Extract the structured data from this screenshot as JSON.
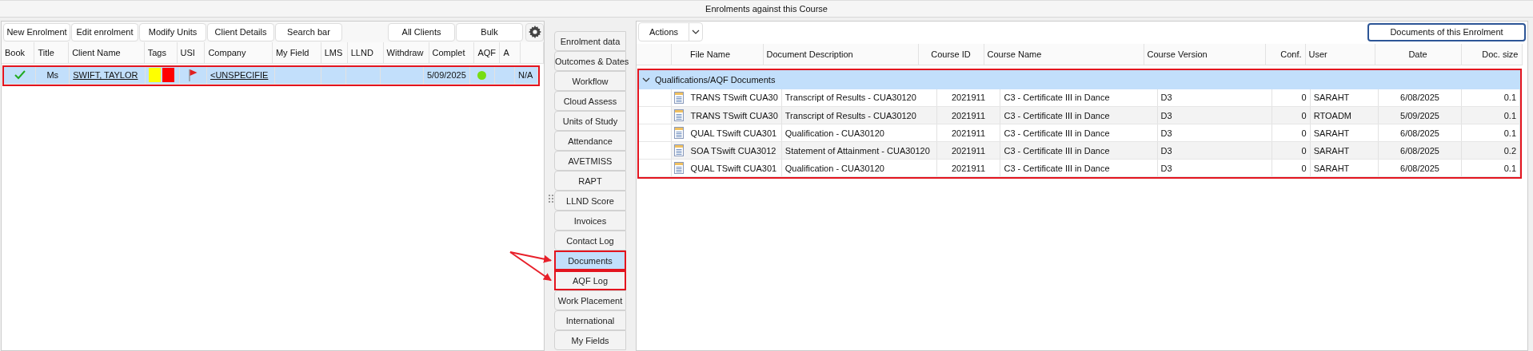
{
  "window": {
    "title": "Enrolments against this Course"
  },
  "enrolments": {
    "toolbar_left": [
      {
        "label": "New Enrolment"
      },
      {
        "label": "Edit enrolment"
      },
      {
        "label": "Modify Units"
      },
      {
        "label": "Client Details"
      },
      {
        "label": "Search bar"
      }
    ],
    "toolbar_right": [
      {
        "label": "All Clients"
      },
      {
        "label": "Bulk"
      }
    ],
    "columns": [
      "Book",
      "Title",
      "Client Name",
      "Tags",
      "USI",
      "Company",
      "My Field",
      "LMS",
      "LLND",
      "Withdraw",
      "Complet",
      "AQF",
      "A",
      ""
    ],
    "rows": [
      {
        "selected": true,
        "highlighted": true,
        "cells": [
          {
            "kind": "check",
            "checked": true
          },
          {
            "kind": "text",
            "text": "Ms"
          },
          {
            "kind": "link",
            "text": "SWIFT, TAYLOR"
          },
          {
            "kind": "tags",
            "tags": [
              {
                "color": "#ffff00"
              },
              {
                "color": "#ff0000"
              }
            ]
          },
          {
            "kind": "flag",
            "flagged": true
          },
          {
            "kind": "link",
            "text": "<UNSPECIFIE"
          },
          {
            "kind": "empty"
          },
          {
            "kind": "empty"
          },
          {
            "kind": "empty"
          },
          {
            "kind": "empty"
          },
          {
            "kind": "text",
            "text": "5/09/2025"
          },
          {
            "kind": "dot",
            "color": "#77dd11"
          },
          {
            "kind": "empty"
          },
          {
            "kind": "text",
            "text": "N/A"
          }
        ]
      }
    ]
  },
  "tabs": [
    {
      "label": "Enrolment data",
      "selected": false,
      "highlighted": false
    },
    {
      "label": "Outcomes & Dates",
      "selected": false,
      "highlighted": false
    },
    {
      "label": "Workflow",
      "selected": false,
      "highlighted": false
    },
    {
      "label": "Cloud Assess",
      "selected": false,
      "highlighted": false
    },
    {
      "label": "Units of Study",
      "selected": false,
      "highlighted": false
    },
    {
      "label": "Attendance",
      "selected": false,
      "highlighted": false
    },
    {
      "label": "AVETMISS",
      "selected": false,
      "highlighted": false
    },
    {
      "label": "RAPT",
      "selected": false,
      "highlighted": false
    },
    {
      "label": "LLND Score",
      "selected": false,
      "highlighted": false
    },
    {
      "label": "Invoices",
      "selected": false,
      "highlighted": false
    },
    {
      "label": "Contact Log",
      "selected": false,
      "highlighted": false
    },
    {
      "label": "Documents",
      "selected": true,
      "highlighted": true
    },
    {
      "label": "AQF Log",
      "selected": false,
      "highlighted": true
    },
    {
      "label": "Work Placement",
      "selected": false,
      "highlighted": false
    },
    {
      "label": "International",
      "selected": false,
      "highlighted": false
    },
    {
      "label": "My Fields",
      "selected": false,
      "highlighted": false
    }
  ],
  "documents": {
    "actions": {
      "label": "Actions"
    },
    "scope_button": {
      "label": "Documents of this Enrolment"
    },
    "columns": [
      "File Name",
      "Document Description",
      "Course ID",
      "Course Name",
      "Course Version",
      "Conf.",
      "User",
      "Date",
      "Doc. size"
    ],
    "groups": [
      {
        "label": "Qualifications/AQF Documents",
        "expanded": true,
        "selected": true,
        "highlighted": true,
        "rows": [
          [
            "TRANS TSwift CUA30",
            "Transcript of Results - CUA30120",
            "2021911",
            "C3 - Certificate III in Dance",
            "D3",
            "0",
            "SARAHT",
            "6/08/2025",
            "0.1"
          ],
          [
            "TRANS TSwift CUA30",
            "Transcript of Results - CUA30120",
            "2021911",
            "C3 - Certificate III in Dance",
            "D3",
            "0",
            "RTOADM",
            "5/09/2025",
            "0.1"
          ],
          [
            "QUAL TSwift CUA301",
            "Qualification - CUA30120",
            "2021911",
            "C3 - Certificate III in Dance",
            "D3",
            "0",
            "SARAHT",
            "6/08/2025",
            "0.1"
          ],
          [
            "SOA TSwift CUA3012",
            "Statement of Attainment - CUA30120",
            "2021911",
            "C3 - Certificate III in Dance",
            "D3",
            "0",
            "SARAHT",
            "6/08/2025",
            "0.2"
          ],
          [
            "QUAL TSwift CUA301",
            "Qualification - CUA30120",
            "2021911",
            "C3 - Certificate III in Dance",
            "D3",
            "0",
            "SARAHT",
            "6/08/2025",
            "0.1"
          ]
        ]
      }
    ]
  }
}
